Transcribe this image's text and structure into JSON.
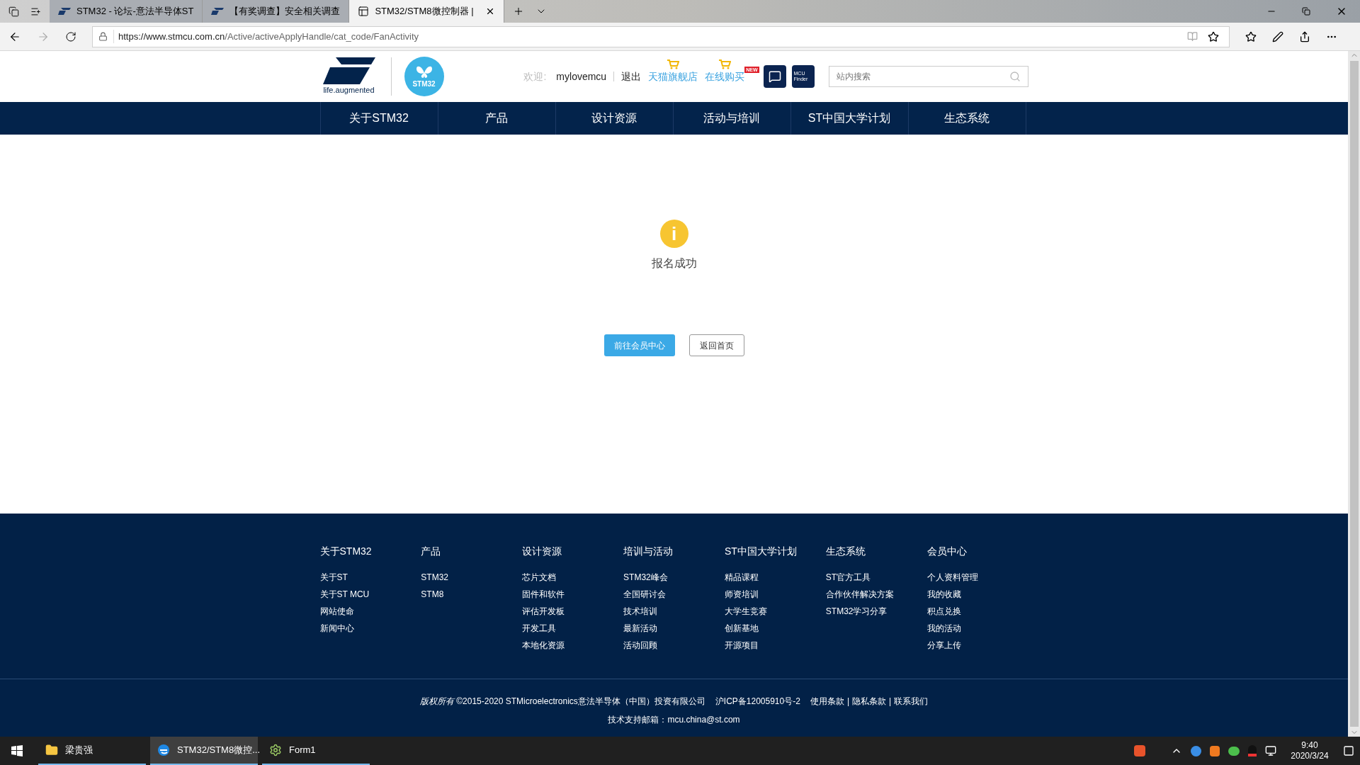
{
  "browser": {
    "tabs": [
      {
        "title": "STM32 - 论坛-意法半导体ST",
        "selected": false,
        "kind": "st"
      },
      {
        "title": "【有奖调查】安全相关调查",
        "selected": false,
        "kind": "st"
      },
      {
        "title": "STM32/STM8微控制器 |",
        "selected": true,
        "kind": "page"
      }
    ],
    "url_host": "https://www.stmcu.com.cn",
    "url_path": "/Active/activeApplyHandle/cat_code/FanActivity"
  },
  "header": {
    "tagline": "life.augmented",
    "stm32_logo": "STM32",
    "welcome": "欢迎:",
    "username": "mylovemcu",
    "logout": "退出",
    "shop_links": [
      "天猫旗舰店",
      "在线购买"
    ],
    "new_badge": "NEW",
    "finder_lines": [
      "MCU",
      "Finder"
    ],
    "search": {
      "placeholder": "站内搜索"
    }
  },
  "nav": [
    "关于STM32",
    "产品",
    "设计资源",
    "活动与培训",
    "ST中国大学计划",
    "生态系统"
  ],
  "message": {
    "icon": "i",
    "text": "报名成功",
    "buttons": [
      {
        "label": "前往会员中心",
        "kind": "primary"
      },
      {
        "label": "返回首页",
        "kind": "default"
      }
    ]
  },
  "footer": {
    "columns": [
      {
        "heading": "关于STM32",
        "links": [
          "关于ST",
          "关于ST MCU",
          "网站使命",
          "新闻中心"
        ]
      },
      {
        "heading": "产品",
        "links": [
          "STM32",
          "STM8"
        ]
      },
      {
        "heading": "设计资源",
        "links": [
          "芯片文档",
          "固件和软件",
          "评估开发板",
          "开发工具",
          "本地化资源"
        ]
      },
      {
        "heading": "培训与活动",
        "links": [
          "STM32峰会",
          "全国研讨会",
          "技术培训",
          "最新活动",
          "活动回顾"
        ]
      },
      {
        "heading": "ST中国大学计划",
        "links": [
          "精品课程",
          "师资培训",
          "大学生竞赛",
          "创新基地",
          "开源项目"
        ]
      },
      {
        "heading": "生态系统",
        "links": [
          "ST官方工具",
          "合作伙伴解决方案",
          "STM32学习分享"
        ]
      },
      {
        "heading": "会员中心",
        "links": [
          "个人资料管理",
          "我的收藏",
          "积点兑换",
          "我的活动",
          "分享上传"
        ]
      }
    ],
    "copyright": "*版权所有* ©2015-2020 STMicroelectronics意法半导体（中国）投资有限公司",
    "icp": "沪ICP备12005910号-2",
    "legal_links": [
      "使用条款",
      "隐私条款",
      "联系我们"
    ],
    "separator": "|",
    "support": "技术支持邮箱：mcu.china@st.com"
  },
  "taskbar": {
    "items": [
      {
        "label": "梁贵强",
        "kind": "folder",
        "selected": false
      },
      {
        "label": "STM32/STM8微控...",
        "kind": "edge",
        "selected": true
      },
      {
        "label": "Form1",
        "kind": "gear",
        "selected": false
      }
    ],
    "time": "9:40",
    "date": "2020/3/24"
  }
}
